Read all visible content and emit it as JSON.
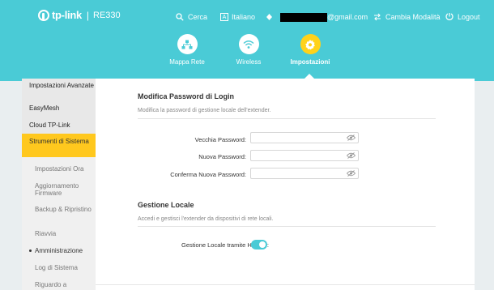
{
  "header": {
    "brand": "tp-link",
    "separator": "|",
    "model": "RE330",
    "search_label": "Cerca",
    "lang_icon_letter": "A",
    "language_label": "Italiano",
    "account_email_suffix": "@gmail.com",
    "mode_label": "Cambia Modalità",
    "logout_label": "Logout"
  },
  "nav": [
    {
      "label": "Mappa Rete",
      "icon": "network-map-icon"
    },
    {
      "label": "Wireless",
      "icon": "wifi-icon"
    },
    {
      "label": "Impostazioni",
      "icon": "gear-icon",
      "active": true
    }
  ],
  "sidebar": {
    "items": [
      {
        "label": "Impostazioni Avanzate",
        "type": "main"
      },
      {
        "label": "EasyMesh",
        "type": "main"
      },
      {
        "label": "Cloud TP-Link",
        "type": "main"
      },
      {
        "label": "Strumenti di Sistema",
        "type": "main",
        "active": true
      },
      {
        "label": "Impostazioni Ora",
        "type": "sub"
      },
      {
        "label": "Aggiornamento Firmware",
        "type": "sub"
      },
      {
        "label": "Backup & Ripristino",
        "type": "sub"
      },
      {
        "label": "Riavvia",
        "type": "sub"
      },
      {
        "label": "Amministrazione",
        "type": "sub",
        "current": true
      },
      {
        "label": "Log di Sistema",
        "type": "sub"
      },
      {
        "label": "Riguardo a",
        "type": "sub"
      }
    ]
  },
  "password_section": {
    "title": "Modifica Password di Login",
    "subtitle": "Modifica la password di gestione locale dell'extender.",
    "fields": [
      {
        "label": "Vecchia Password:",
        "value": ""
      },
      {
        "label": "Nuova Password:",
        "value": ""
      },
      {
        "label": "Conferma Nuova Password:",
        "value": ""
      }
    ]
  },
  "local_section": {
    "title": "Gestione Locale",
    "subtitle": "Accedi e gestisci l'extender da dispositivi di rete locali.",
    "https_label": "Gestione Locale tramite HTTPS:",
    "https_enabled": true
  },
  "colors": {
    "header": "#4acbd6",
    "accent": "#ffc81e"
  }
}
